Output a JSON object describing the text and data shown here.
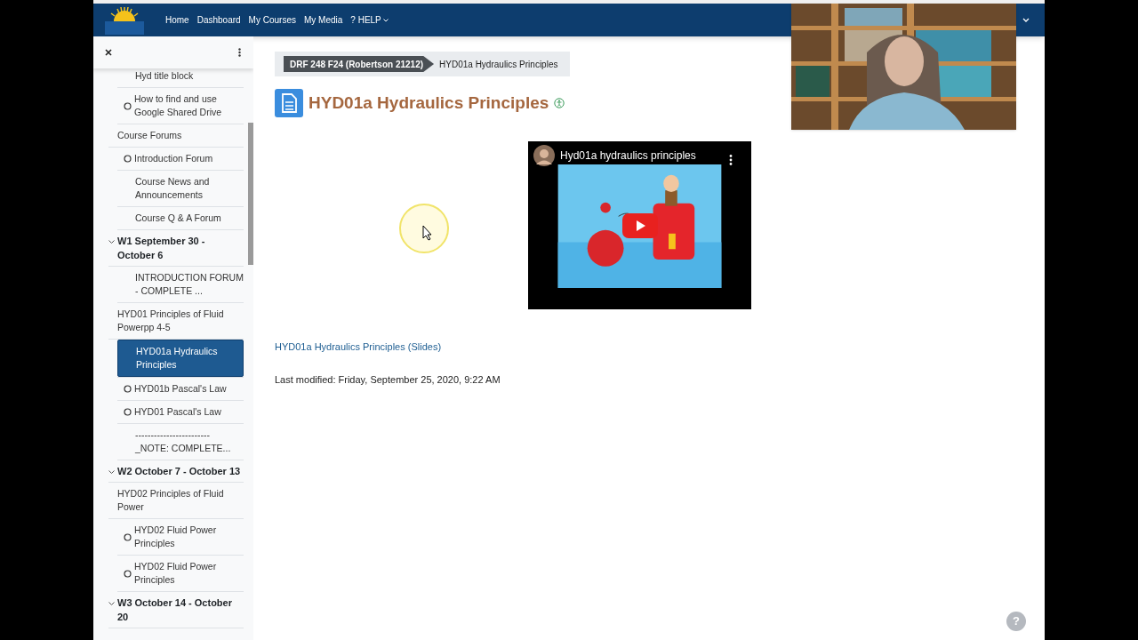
{
  "nav": {
    "items": [
      {
        "label": "Home",
        "kind": "link"
      },
      {
        "label": "Dashboard",
        "kind": "link"
      },
      {
        "label": "My Courses",
        "kind": "link"
      },
      {
        "label": "My Media",
        "kind": "link"
      },
      {
        "label": "? HELP",
        "kind": "menu"
      }
    ]
  },
  "sidebar": {
    "items": [
      {
        "label": "Hyd title block",
        "kind": "page",
        "selected": false
      },
      {
        "label": "How to find and use Google Shared Drive",
        "kind": "activity",
        "selected": false
      },
      {
        "label": "Course Forums",
        "kind": "link",
        "selected": false
      },
      {
        "label": "Introduction Forum",
        "kind": "activity",
        "selected": false
      },
      {
        "label": "Course News and Announcements",
        "kind": "page",
        "selected": false
      },
      {
        "label": "Course Q & A Forum",
        "kind": "page",
        "selected": false
      },
      {
        "label": "W1 September 30 - October 6",
        "kind": "section",
        "expanded": true,
        "children": [
          {
            "label": "INTRODUCTION FORUM - COMPLETE ...",
            "kind": "page",
            "selected": false
          },
          {
            "label": "HYD01 Principles of Fluid Powerpp 4-5",
            "kind": "link",
            "selected": false
          },
          {
            "label": "HYD01a Hydraulics Principles",
            "kind": "page",
            "selected": true
          },
          {
            "label": "HYD01b Pascal's Law",
            "kind": "activity",
            "selected": false
          },
          {
            "label": "HYD01 Pascal's Law",
            "kind": "activity",
            "selected": false
          },
          {
            "label": "------------------------ _NOTE: COMPLETE...",
            "kind": "page",
            "selected": false
          }
        ]
      },
      {
        "label": "W2 October 7 - October 13",
        "kind": "section",
        "expanded": true,
        "children": [
          {
            "label": "HYD02 Principles of Fluid Power",
            "kind": "link",
            "selected": false
          },
          {
            "label": "HYD02 Fluid Power Principles",
            "kind": "activity",
            "selected": false
          },
          {
            "label": "HYD02 Fluid Power Principles",
            "kind": "activity",
            "selected": false
          }
        ]
      },
      {
        "label": "W3 October 14 - October 20",
        "kind": "section",
        "expanded": true
      }
    ]
  },
  "breadcrumb": [
    {
      "label": "DRF 248 F24 (Robertson 21212)"
    },
    {
      "label": "HYD01a Hydraulics Principles"
    }
  ],
  "page": {
    "title": "HYD01a Hydraulics Principles",
    "video": {
      "title": "Hyd01a hydraulics principles"
    },
    "link": "HYD01a Hydraulics Principles (Slides)",
    "modified": "Last modified: Friday, September 25, 2020, 9:22 AM"
  },
  "help_button": "?"
}
